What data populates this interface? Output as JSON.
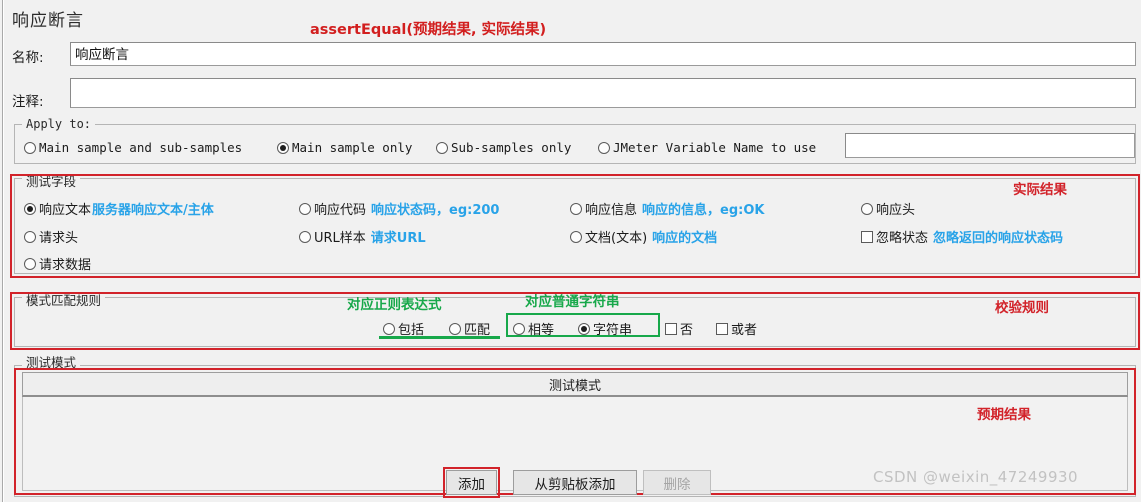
{
  "panel": {
    "title": "响应断言",
    "annotation_assert": "assertEqual(预期结果, 实际结果)"
  },
  "fields": {
    "name_label": "名称:",
    "name_value": "响应断言",
    "comment_label": "注释:",
    "comment_value": ""
  },
  "apply_to": {
    "group_title": "Apply to:",
    "options": [
      {
        "label": "Main sample and sub-samples",
        "selected": false
      },
      {
        "label": "Main sample only",
        "selected": true
      },
      {
        "label": "Sub-samples only",
        "selected": false
      },
      {
        "label": "JMeter Variable Name to use",
        "selected": false
      }
    ],
    "variable_value": ""
  },
  "test_field": {
    "group_title": "测试字段",
    "annotation": "实际结果",
    "options": [
      {
        "label": "响应文本",
        "hint": "服务器响应文本/主体",
        "type": "radio",
        "selected": true
      },
      {
        "label": "请求头",
        "hint": "",
        "type": "radio",
        "selected": false
      },
      {
        "label": "请求数据",
        "hint": "",
        "type": "radio",
        "selected": false
      },
      {
        "label": "响应代码",
        "hint": "响应状态码，eg:200",
        "type": "radio",
        "selected": false
      },
      {
        "label": "URL样本",
        "hint": "请求URL",
        "type": "radio",
        "selected": false
      },
      {
        "label": "响应信息",
        "hint": "响应的信息，eg:OK",
        "type": "radio",
        "selected": false
      },
      {
        "label": "文档(文本)",
        "hint": "响应的文档",
        "type": "radio",
        "selected": false
      },
      {
        "label": "响应头",
        "hint": "",
        "type": "radio",
        "selected": false
      },
      {
        "label": "忽略状态",
        "hint": "忽略返回的响应状态码",
        "type": "checkbox",
        "selected": false
      }
    ]
  },
  "pattern_rules": {
    "group_title": "模式匹配规则",
    "annotation": "校验规则",
    "annotation_regex": "对应正则表达式",
    "annotation_plain": "对应普通字符串",
    "options": [
      {
        "label": "包括",
        "type": "radio",
        "selected": false
      },
      {
        "label": "匹配",
        "type": "radio",
        "selected": false
      },
      {
        "label": "相等",
        "type": "radio",
        "selected": false
      },
      {
        "label": "字符串",
        "type": "radio",
        "selected": true
      },
      {
        "label": "否",
        "type": "checkbox",
        "selected": false
      },
      {
        "label": "或者",
        "type": "checkbox",
        "selected": false
      }
    ]
  },
  "test_patterns": {
    "group_title": "测试模式",
    "table_header": "测试模式",
    "annotation": "预期结果",
    "rows": [],
    "buttons": [
      {
        "label": "添加",
        "enabled": true,
        "highlighted": true
      },
      {
        "label": "从剪贴板添加",
        "enabled": true,
        "highlighted": false
      },
      {
        "label": "删除",
        "enabled": false,
        "highlighted": false
      }
    ]
  },
  "watermark": "CSDN @weixin_47249930",
  "colors": {
    "annotation_red": "#d2232a",
    "annotation_green": "#17a84a",
    "hint_blue": "#29a3e8",
    "panel_bg": "#f1f1f1"
  }
}
